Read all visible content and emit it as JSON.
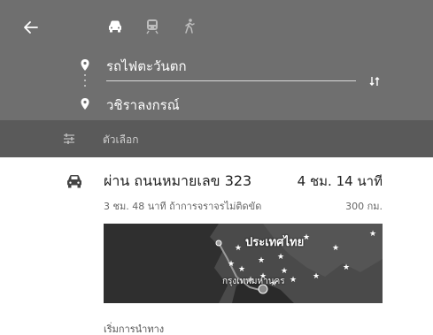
{
  "header": {
    "modes": [
      {
        "name": "driving",
        "icon": "car-icon",
        "active": true
      },
      {
        "name": "transit",
        "icon": "train-icon",
        "active": false
      },
      {
        "name": "walking",
        "icon": "walk-icon",
        "active": false
      }
    ],
    "origin": "รถไฟตะวันตก",
    "destination": "วชิราลงกรณ์"
  },
  "options": {
    "label": "ตัวเลือก"
  },
  "route": {
    "title": "ผ่าน ถนนหมายเลข 323",
    "duration": "4 ชม. 14 นาที",
    "subtitle": "3 ชม. 48 นาที ถ้าการจราจรไม่ติดขัด",
    "distance": "300 กม.",
    "map": {
      "country_label": "ประเทศไทย",
      "city_label": "กรุงเทพมหานคร"
    },
    "start_label": "เริ่มการนำทาง"
  },
  "colors": {
    "header_bg": "#6f6f6f",
    "options_bg": "#5a5a5a",
    "map_bg": "#3a3a3a"
  }
}
